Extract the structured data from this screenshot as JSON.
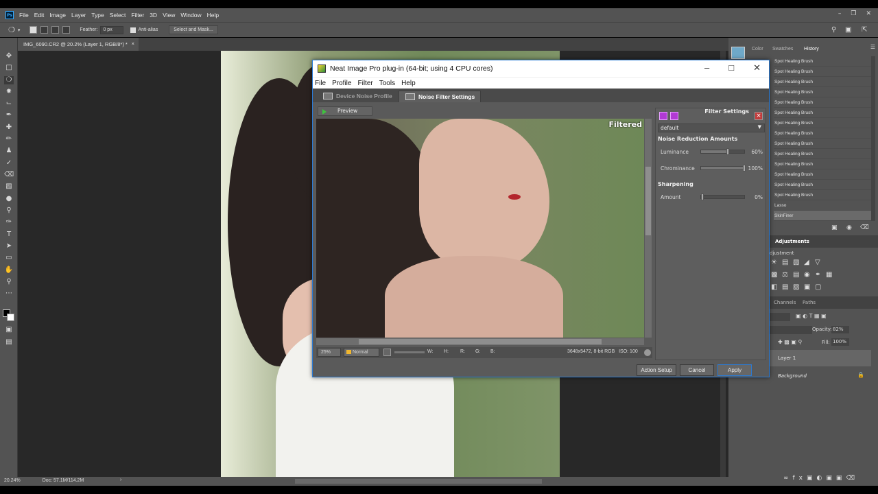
{
  "photoshop": {
    "menus": [
      "File",
      "Edit",
      "Image",
      "Layer",
      "Type",
      "Select",
      "Filter",
      "3D",
      "View",
      "Window",
      "Help"
    ],
    "logo": "Ps",
    "options": {
      "feather_label": "Feather:",
      "feather_value": "0 px",
      "antialias_label": "Anti-alias",
      "select_mask_label": "Select and Mask..."
    },
    "doc_tab": "IMG_6090.CR2 @ 20.2% (Layer 1, RGB/8*) *",
    "status": {
      "zoom": "20.24%",
      "doc": "Doc: 57.1M/114.2M"
    },
    "panels": {
      "color_tab": "Color",
      "swatches_tab": "Swatches",
      "history_tab": "History",
      "history_items": [
        "Spot Healing Brush",
        "Spot Healing Brush",
        "Spot Healing Brush",
        "Spot Healing Brush",
        "Spot Healing Brush",
        "Spot Healing Brush",
        "Spot Healing Brush",
        "Spot Healing Brush",
        "Spot Healing Brush",
        "Spot Healing Brush",
        "Spot Healing Brush",
        "Spot Healing Brush",
        "Spot Healing Brush",
        "Spot Healing Brush",
        "Lasso",
        "SkinFiner"
      ],
      "adjustments_tab": "Adjustments",
      "adjustment_label": "djustment",
      "channels_tab": "Channels",
      "paths_tab": "Paths",
      "opacity_label": "Opacity:",
      "opacity_value": "82%",
      "fill_label": "Fill:",
      "fill_value": "100%",
      "layers": [
        "Layer 1",
        "Background"
      ]
    }
  },
  "neat_image": {
    "title": "Neat Image Pro plug-in (64-bit; using 4 CPU cores)",
    "menus": [
      "File",
      "Profile",
      "Filter",
      "Tools",
      "Help"
    ],
    "tabs": [
      "Device Noise Profile",
      "Noise Filter Settings"
    ],
    "preview_label": "Preview",
    "view_label": "Filtered",
    "statusbar": {
      "zoom": "25%",
      "mode": "Normal",
      "w": "W:",
      "h": "H:",
      "r": "R:",
      "g": "G:",
      "b": "B:",
      "info": "3648x5472, 8-bit RGB   ISO: 100"
    },
    "settings": {
      "title": "Filter Settings",
      "profile": "default",
      "noise_header": "Noise Reduction Amounts",
      "luminance_label": "Luminance",
      "luminance_value": "60%",
      "chrominance_label": "Chrominance",
      "chrominance_value": "100%",
      "sharpening_header": "Sharpening",
      "amount_label": "Amount",
      "amount_value": "0%"
    },
    "sliders": {
      "luminance": 0.6,
      "chrominance": 1.0,
      "amount": 0.0
    },
    "buttons": {
      "action_setup": "Action Setup",
      "cancel": "Cancel",
      "apply": "Apply"
    }
  }
}
